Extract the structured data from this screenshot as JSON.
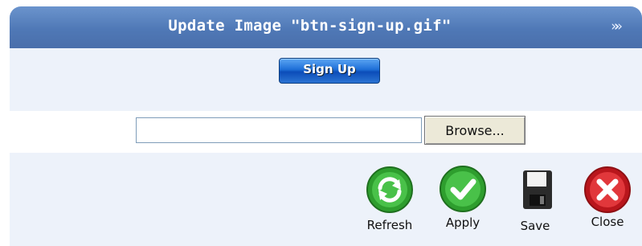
{
  "dialog": {
    "title": "Update Image \"btn-sign-up.gif\"",
    "collapse_glyph": "»»"
  },
  "preview": {
    "button_text": "Sign Up"
  },
  "upload": {
    "value": "",
    "browse_label": "Browse..."
  },
  "toolbar": {
    "refresh_label": "Refresh",
    "apply_label": "Apply",
    "save_label": "Save",
    "close_label": "Close"
  },
  "colors": {
    "header": "#4f78b6",
    "panel": "#edf2fa",
    "green": "#3aa83a",
    "red": "#d3262d",
    "blue_button": "#1e6fd7"
  },
  "icons": [
    "refresh-icon",
    "check-icon",
    "floppy-disk-icon",
    "close-x-icon"
  ]
}
